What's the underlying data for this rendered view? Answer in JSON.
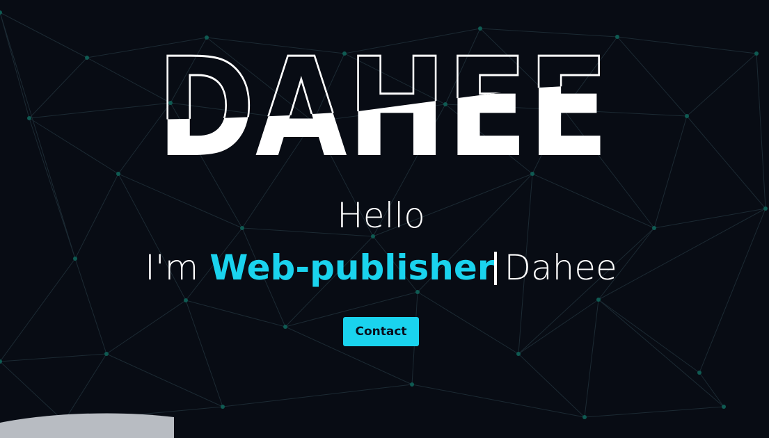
{
  "colors": {
    "background": "#080c14",
    "accent": "#1ad3ee",
    "network_line": "#1c2a33",
    "network_node": "#0f5a52",
    "wave": "#b8bcc2"
  },
  "hero": {
    "logo_text": "DAHEE",
    "hello": "Hello",
    "intro_prefix": "I'm ",
    "intro_role": "Web-publisher",
    "intro_name": "Dahee",
    "contact_label": "Contact"
  }
}
